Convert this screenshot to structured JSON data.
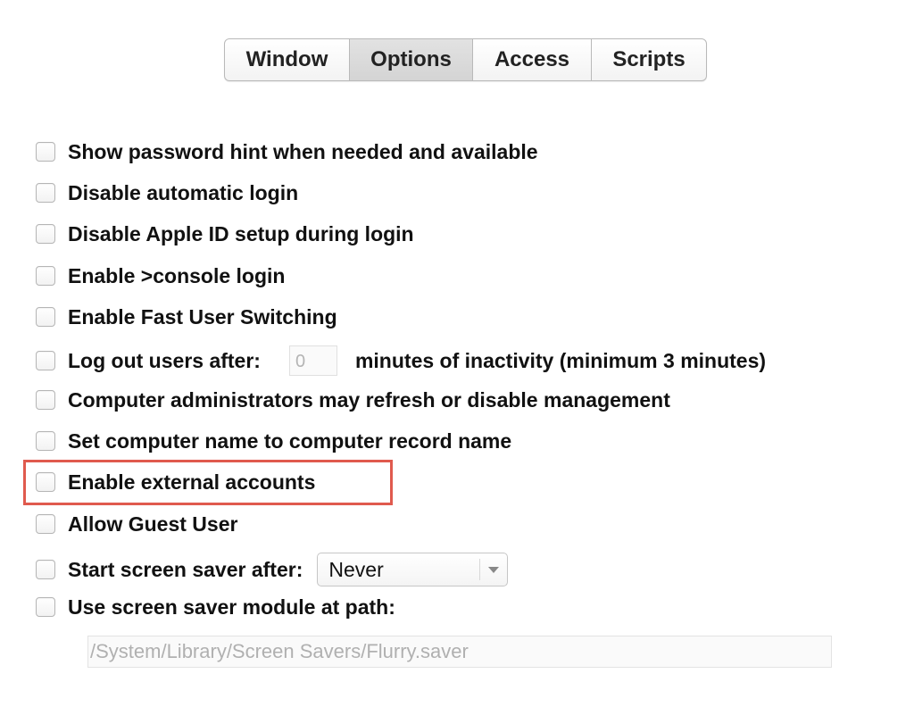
{
  "tabs": [
    {
      "label": "Window",
      "selected": false
    },
    {
      "label": "Options",
      "selected": true
    },
    {
      "label": "Access",
      "selected": false
    },
    {
      "label": "Scripts",
      "selected": false
    }
  ],
  "options": {
    "show_password_hint": {
      "label": "Show password hint when needed and available",
      "checked": false
    },
    "disable_auto_login": {
      "label": "Disable automatic login",
      "checked": false
    },
    "disable_apple_id": {
      "label": "Disable Apple ID setup during login",
      "checked": false
    },
    "enable_console_login": {
      "label": "Enable >console login",
      "checked": false
    },
    "enable_fast_user_switching": {
      "label": "Enable Fast User Switching",
      "checked": false
    },
    "log_out_users": {
      "label": "Log out users after:",
      "checked": false,
      "minutes_value": "0",
      "suffix": "minutes of inactivity (minimum 3 minutes)"
    },
    "admins_refresh": {
      "label": "Computer administrators may refresh or disable management",
      "checked": false
    },
    "set_computer_name": {
      "label": "Set computer name to computer record name",
      "checked": false
    },
    "enable_external_accounts": {
      "label": "Enable external accounts",
      "checked": false
    },
    "allow_guest_user": {
      "label": "Allow Guest User",
      "checked": false
    },
    "screen_saver_after": {
      "label": "Start screen saver after:",
      "checked": false,
      "selected_value": "Never"
    },
    "screen_saver_module": {
      "label": "Use screen saver module at path:",
      "checked": false,
      "path_placeholder": "/System/Library/Screen Savers/Flurry.saver"
    }
  },
  "colors": {
    "highlight": "#e05a4e",
    "selected_tab": "#d8d8d8"
  }
}
